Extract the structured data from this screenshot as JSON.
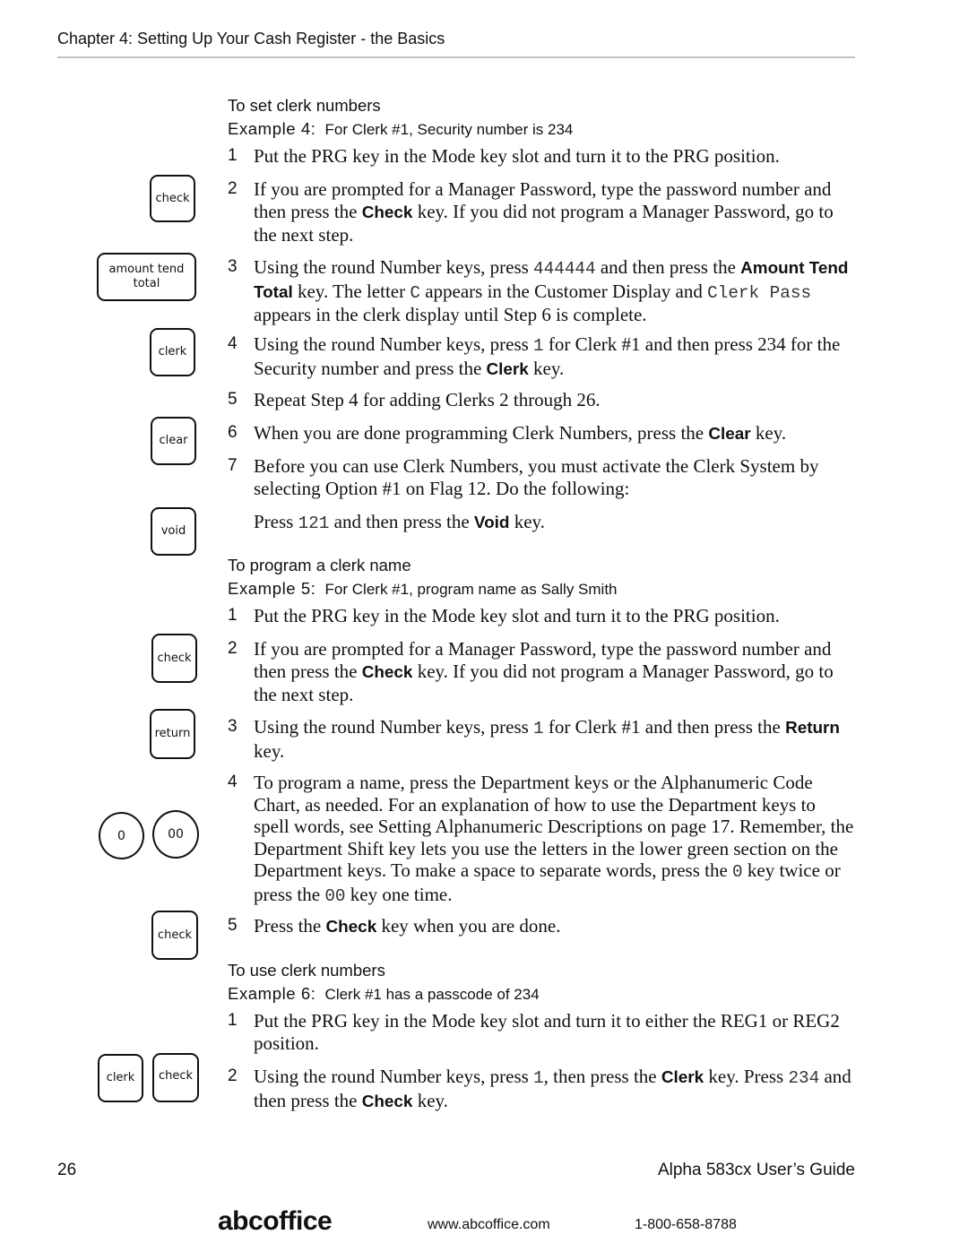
{
  "header": {
    "title": "Chapter 4:   Setting Up Your Cash Register - the Basics"
  },
  "sections": [
    {
      "title": "To set clerk numbers",
      "example_label": "Example 4:",
      "example_text": "For Clerk #1, Security number is 234",
      "steps": [
        {
          "num": "1",
          "parts": [
            "Put the PRG key in the Mode key slot and turn it to the PRG position."
          ]
        },
        {
          "num": "2",
          "parts": [
            "If you are prompted for a Manager Password, type the password number and then press the ",
            {
              "b": "Check"
            },
            " key. If you did not program a Manager Password, go to the next step."
          ]
        },
        {
          "num": "3",
          "parts": [
            "Using the round Number keys, press ",
            {
              "m": "444444"
            },
            " and then press the ",
            {
              "b": "Amount Tend Total"
            },
            " key. The letter ",
            {
              "m": "C"
            },
            " appears in the Customer Display and ",
            {
              "m": "Clerk Pass"
            },
            " appears in the clerk display until Step 6 is complete."
          ]
        },
        {
          "num": "4",
          "parts": [
            "Using the round Number keys, press ",
            {
              "m": "1"
            },
            " for Clerk #1 and then press 234 for the Security number and press the ",
            {
              "b": "Clerk"
            },
            " key."
          ]
        },
        {
          "num": "5",
          "parts": [
            "Repeat Step 4 for adding Clerks 2 through 26."
          ]
        },
        {
          "num": "6",
          "parts": [
            "When you are done programming Clerk Numbers, press the ",
            {
              "b": "Clear"
            },
            " key."
          ]
        },
        {
          "num": "7",
          "parts": [
            "Before you can use Clerk Numbers, you must activate the Clerk System by selecting Option #1 on Flag 12. Do the following:"
          ]
        },
        {
          "num": "",
          "parts": [
            "Press ",
            {
              "m": "121"
            },
            " and then press the ",
            {
              "b": "Void"
            },
            " key."
          ]
        }
      ]
    },
    {
      "title": "To program a clerk name",
      "example_label": "Example 5:",
      "example_text": "For Clerk #1, program name as Sally Smith",
      "steps": [
        {
          "num": "1",
          "parts": [
            "Put the PRG key in the Mode key slot and turn it to the PRG position."
          ]
        },
        {
          "num": "2",
          "parts": [
            "If you are prompted for a Manager Password, type the password number and then press the ",
            {
              "b": "Check"
            },
            " key. If you did not program a Manager Password, go to the next step."
          ]
        },
        {
          "num": "3",
          "parts": [
            "Using the round Number keys, press ",
            {
              "m": "1"
            },
            " for Clerk #1 and then press the ",
            {
              "b": "Return"
            },
            " key."
          ]
        },
        {
          "num": "4",
          "parts": [
            "To program a name, press the Department keys or the Alphanumeric Code Chart, as needed. For an explanation of how to use the Department keys to spell words, see Setting Alphanumeric Descriptions on page 17. Remember, the Department Shift key lets you use the letters in the lower green section on the Department keys. To make a space to separate words, press the ",
            {
              "m": "0"
            },
            " key twice or press the ",
            {
              "m": "00"
            },
            " key one time."
          ]
        },
        {
          "num": "5",
          "parts": [
            "Press the ",
            {
              "b": "Check"
            },
            " key when you are done."
          ]
        }
      ]
    },
    {
      "title": "To use clerk numbers",
      "example_label": "Example 6:",
      "example_text": "Clerk #1 has a passcode of 234",
      "steps": [
        {
          "num": "1",
          "parts": [
            "Put the PRG key in the Mode key slot and turn it to either the REG1 or REG2 position."
          ]
        },
        {
          "num": "2",
          "parts": [
            "Using the round Number keys, press ",
            {
              "m": "1"
            },
            ", then press the ",
            {
              "b": "Clerk"
            },
            " key. Press ",
            {
              "m": "234"
            },
            " and then press the ",
            {
              "b": "Check"
            },
            " key."
          ]
        }
      ]
    }
  ],
  "keys": [
    {
      "name": "check-key",
      "label": "check",
      "shape": "square"
    },
    {
      "name": "amount-tend-total-key",
      "label": "amount tend total",
      "shape": "wide"
    },
    {
      "name": "clerk-key",
      "label": "clerk",
      "shape": "square"
    },
    {
      "name": "clear-key",
      "label": "clear",
      "shape": "square"
    },
    {
      "name": "void-key",
      "label": "void",
      "shape": "square"
    },
    {
      "name": "check-key",
      "label": "check",
      "shape": "square"
    },
    {
      "name": "return-key",
      "label": "return",
      "shape": "square"
    },
    {
      "name": "zero-key",
      "label": "0",
      "shape": "round"
    },
    {
      "name": "double-zero-key",
      "label": "00",
      "shape": "round"
    },
    {
      "name": "check-key",
      "label": "check",
      "shape": "square"
    },
    {
      "name": "clerk-key",
      "label": "clerk",
      "shape": "square"
    },
    {
      "name": "check-key",
      "label": "check",
      "shape": "square"
    }
  ],
  "footer": {
    "page_number": "26",
    "guide_title": "Alpha 583cx  User’s Guide",
    "brand": "abcoffice",
    "website": "www.abcoffice.com",
    "phone": "1-800-658-8788"
  }
}
